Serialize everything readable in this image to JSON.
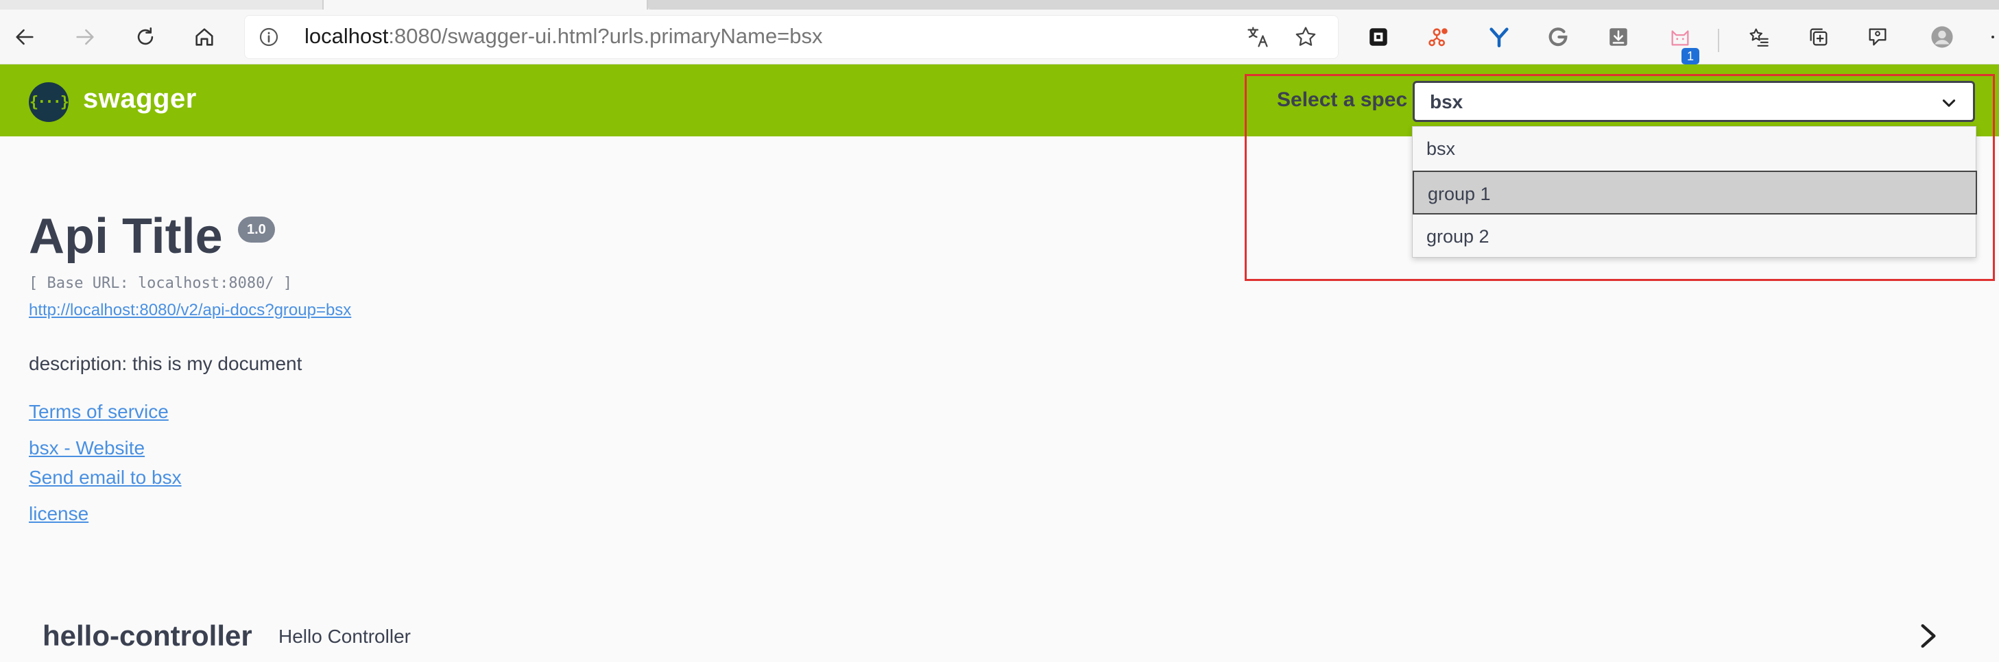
{
  "browser": {
    "url_host": "localhost",
    "url_rest": ":8080/swagger-ui.html?urls.primaryName=bsx",
    "extension_badge": "1",
    "icons": [
      "back-icon",
      "forward-icon",
      "refresh-icon",
      "home-icon",
      "info-icon",
      "translate-icon",
      "star-icon",
      "extension-square-icon",
      "extension-network-icon",
      "extension-y-icon",
      "extension-g-icon",
      "download-icon",
      "extension-cat-icon",
      "favorites-icon",
      "collections-icon",
      "feedback-icon",
      "profile-icon",
      "more-icon"
    ]
  },
  "topbar": {
    "brand": "swagger",
    "logo_glyph": "{···}",
    "spec_label": "Select a spec",
    "spec_selected": "bsx",
    "accent": "#89bf04"
  },
  "dropdown": {
    "options": [
      "bsx",
      "group 1",
      "group 2"
    ],
    "highlighted": "group 1"
  },
  "info": {
    "title": "Api Title",
    "version": "1.0",
    "base_url": "[ Base URL: localhost:8080/ ]",
    "api_docs_link": "http://localhost:8080/v2/api-docs?group=bsx",
    "description": "description: this is my document",
    "terms": "Terms of service",
    "website": "bsx - Website",
    "email": "Send email to bsx",
    "license": "license"
  },
  "controllers": [
    {
      "name": "hello-controller",
      "description": "Hello Controller"
    }
  ]
}
